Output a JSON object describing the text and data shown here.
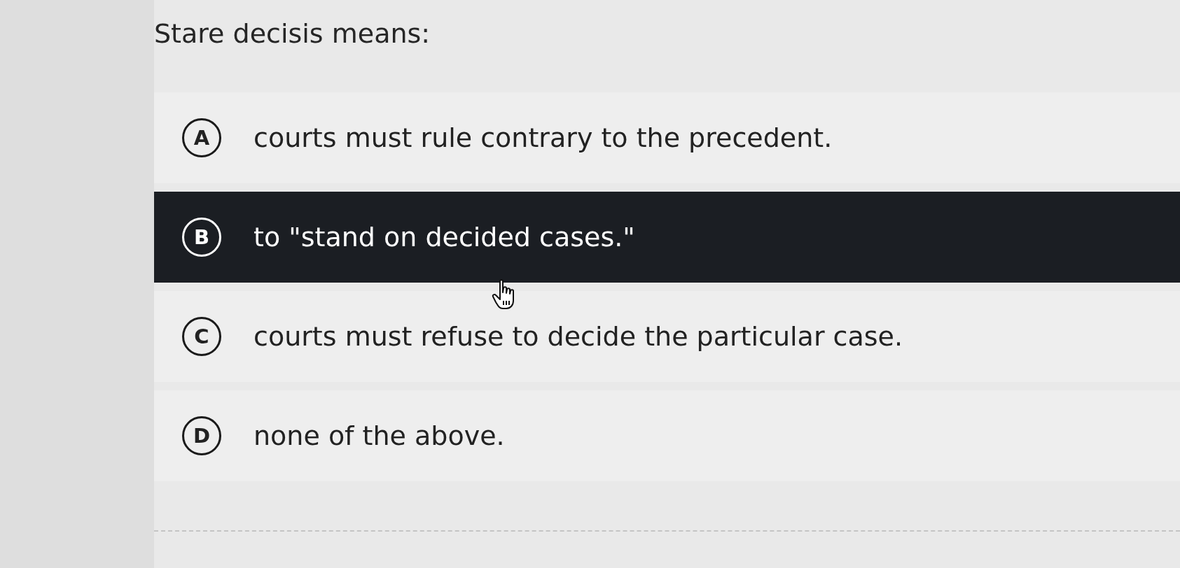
{
  "question": {
    "text": "Stare decisis means:"
  },
  "options": [
    {
      "letter": "A",
      "text": "courts must rule contrary to the precedent.",
      "selected": false
    },
    {
      "letter": "B",
      "text": "to \"stand on decided cases.\"",
      "selected": true
    },
    {
      "letter": "C",
      "text": "courts must refuse to decide the particular case.",
      "selected": false
    },
    {
      "letter": "D",
      "text": "none of the above.",
      "selected": false
    }
  ]
}
